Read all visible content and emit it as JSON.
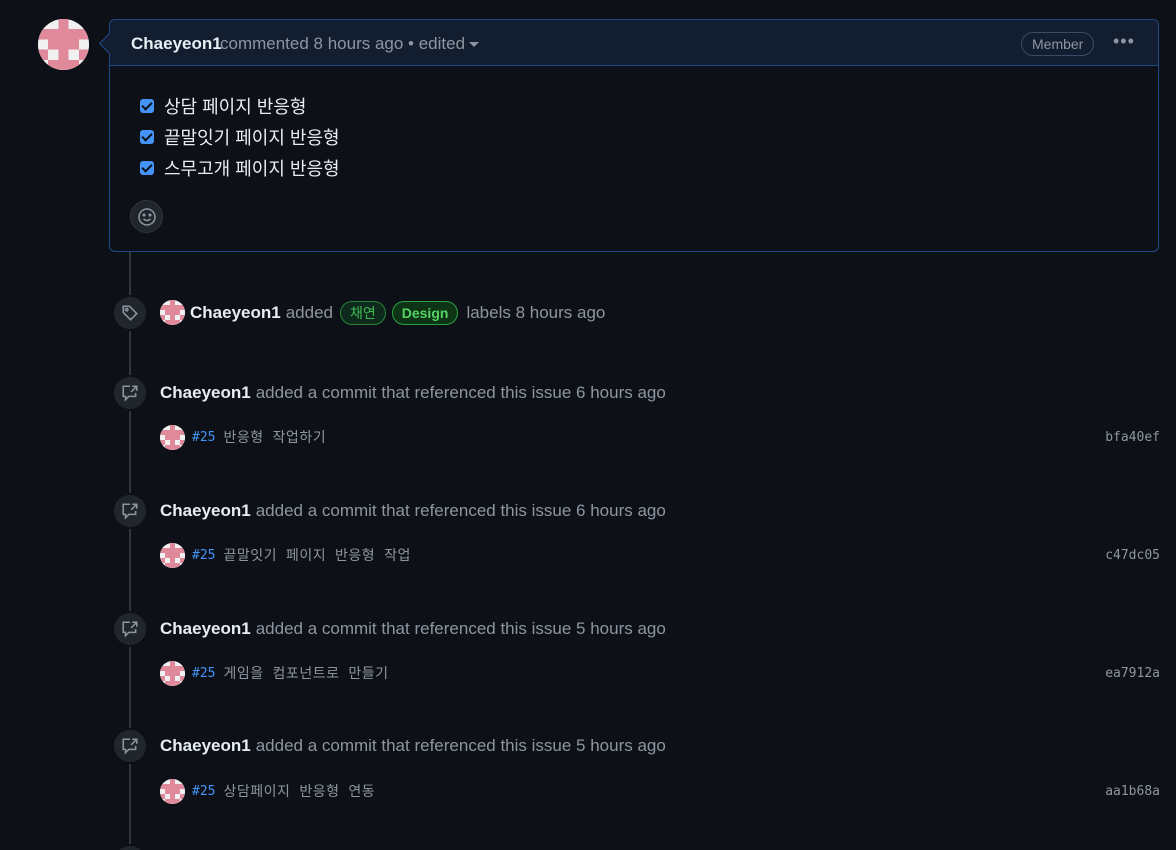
{
  "comment": {
    "author": "Chaeyeon1",
    "meta": "commented 8 hours ago • edited",
    "badge": "Member",
    "tasks": [
      {
        "label": "상담 페이지 반응형",
        "checked": true
      },
      {
        "label": "끝말잇기 페이지 반응형",
        "checked": true
      },
      {
        "label": "스무고개 페이지 반응형",
        "checked": true
      }
    ]
  },
  "label_event": {
    "author": "Chaeyeon1",
    "action": "added",
    "labels": [
      "채연",
      "Design"
    ],
    "suffix": "labels 8 hours ago"
  },
  "commit_events": [
    {
      "author": "Chaeyeon1",
      "text": "added a commit that referenced this issue 6 hours ago",
      "ref": "#25",
      "message": "반응형 작업하기",
      "sha": "bfa40ef"
    },
    {
      "author": "Chaeyeon1",
      "text": "added a commit that referenced this issue 6 hours ago",
      "ref": "#25",
      "message": "끝말잇기 페이지 반응형 작업",
      "sha": "c47dc05"
    },
    {
      "author": "Chaeyeon1",
      "text": "added a commit that referenced this issue 5 hours ago",
      "ref": "#25",
      "message": "게임을 컴포넌트로 만들기",
      "sha": "ea7912a"
    },
    {
      "author": "Chaeyeon1",
      "text": "added a commit that referenced this issue 5 hours ago",
      "ref": "#25",
      "message": "상담페이지 반응형 연동",
      "sha": "aa1b68a"
    }
  ],
  "icons": {
    "avatar": "identicon-pink",
    "tag": "tag-icon",
    "commit_reference": "cross-reference-icon",
    "reaction": "smiley-icon",
    "more": "kebab-horizontal-icon"
  },
  "colors": {
    "background": "#0d1117",
    "accent_blue": "#4493f8",
    "label_green": "#3fb950",
    "identicon_pink": "#e0899a"
  }
}
